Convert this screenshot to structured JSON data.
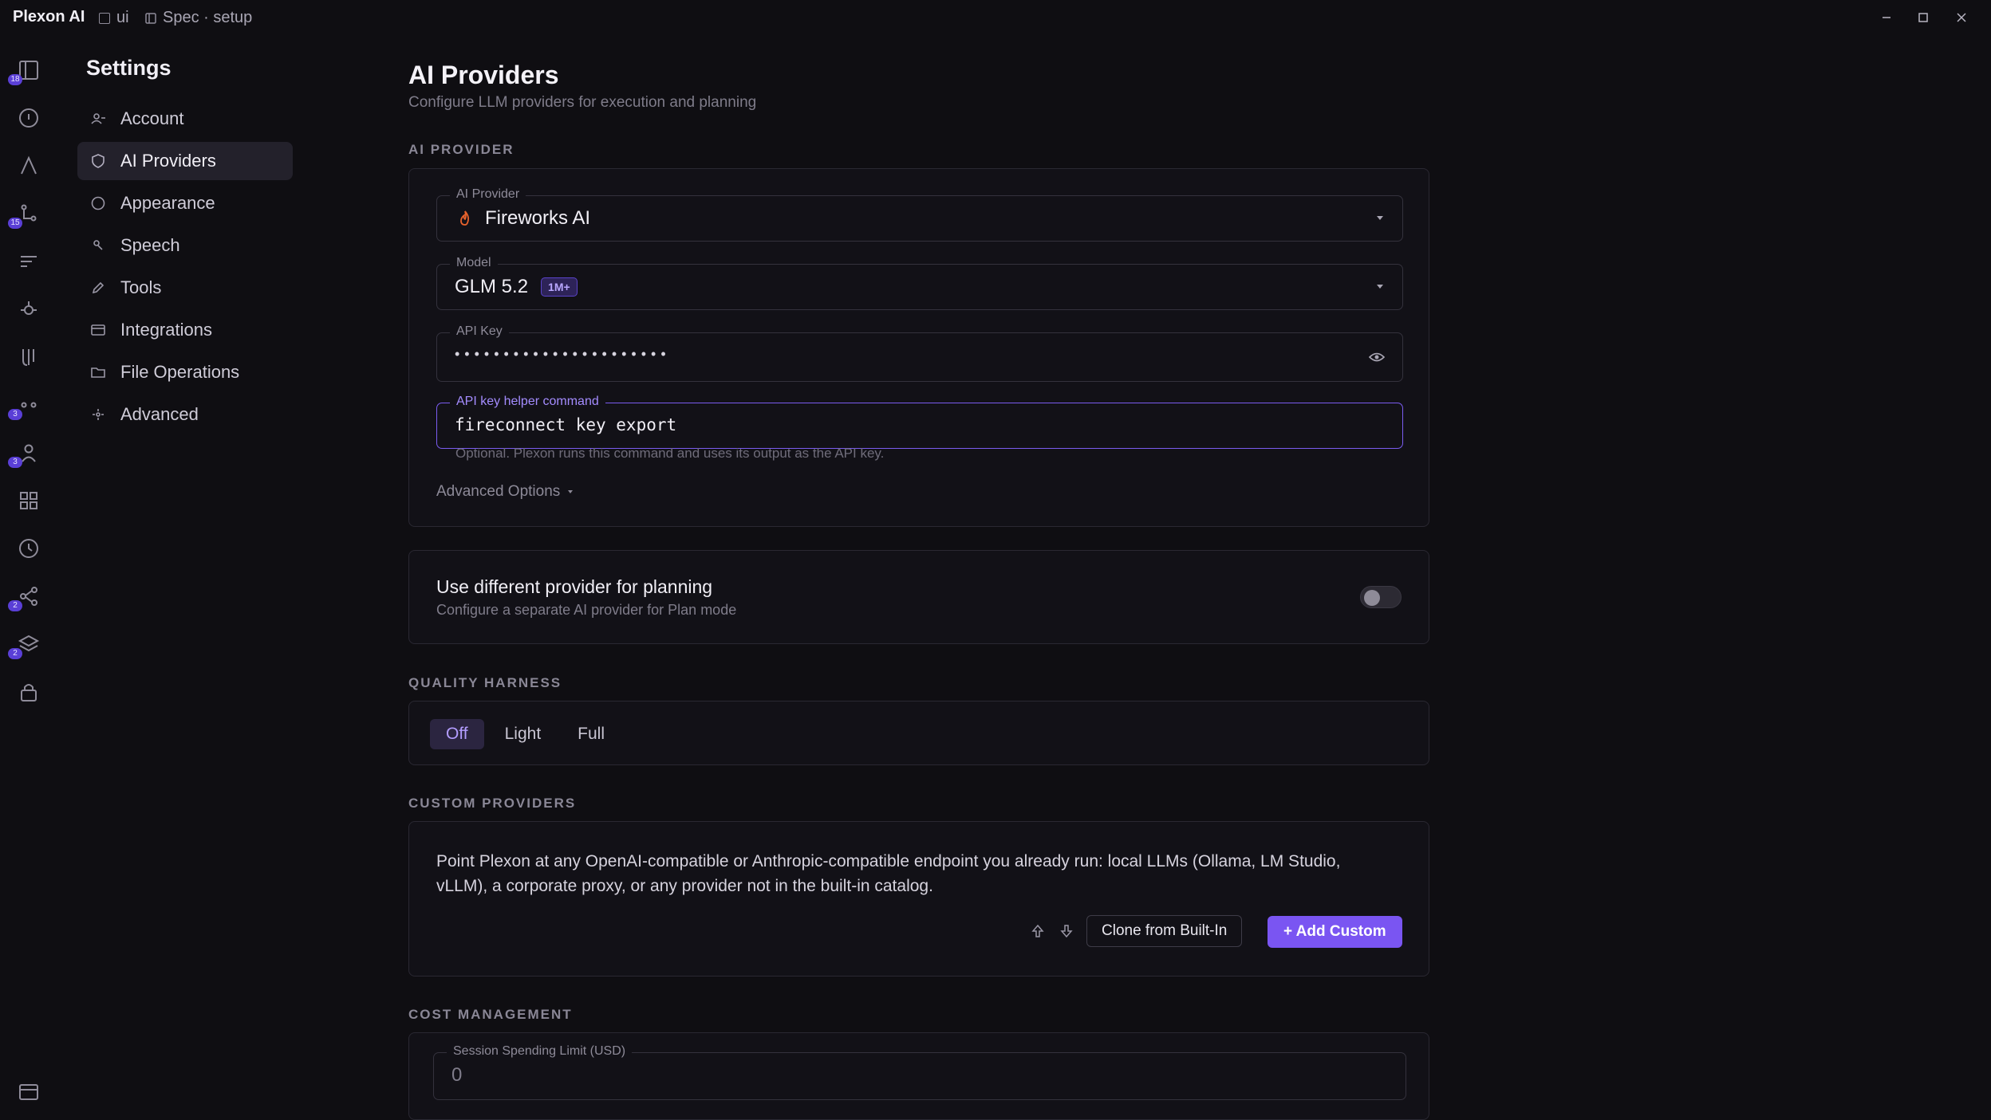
{
  "titlebar": {
    "app_name": "Plexon AI",
    "tabs": [
      {
        "label": "ui",
        "icon": "square-icon"
      },
      {
        "label": "Spec · setup",
        "icon": "panel-icon"
      }
    ]
  },
  "rail": {
    "badges": {
      "panel": "18",
      "branch": "15",
      "dots": "3",
      "user": "3",
      "share": "2",
      "layers": "2"
    }
  },
  "settings": {
    "title": "Settings",
    "nav": [
      {
        "label": "Account",
        "icon": "user-icon"
      },
      {
        "label": "AI Providers",
        "icon": "shield-icon",
        "active": true
      },
      {
        "label": "Appearance",
        "icon": "circle-icon"
      },
      {
        "label": "Speech",
        "icon": "mic-icon"
      },
      {
        "label": "Tools",
        "icon": "pencil-icon"
      },
      {
        "label": "Integrations",
        "icon": "card-icon"
      },
      {
        "label": "File Operations",
        "icon": "folder-icon"
      },
      {
        "label": "Advanced",
        "icon": "sparkle-icon"
      }
    ]
  },
  "page": {
    "title": "AI Providers",
    "subtitle": "Configure LLM providers for execution and planning"
  },
  "ai_provider": {
    "section": "AI PROVIDER",
    "provider_label": "AI Provider",
    "provider_value": "Fireworks AI",
    "model_label": "Model",
    "model_value": "GLM 5.2",
    "model_badge": "1M+",
    "api_key_label": "API Key",
    "api_key_masked": "••••••••••••••••••••••",
    "helper_label": "API key helper command",
    "helper_value": "fireconnect key export",
    "helper_hint": "Optional. Plexon runs this command and uses its output as the API key.",
    "advanced": "Advanced Options"
  },
  "planning": {
    "title": "Use different provider for planning",
    "desc": "Configure a separate AI provider for Plan mode",
    "enabled": false
  },
  "quality": {
    "section": "QUALITY HARNESS",
    "options": [
      "Off",
      "Light",
      "Full"
    ],
    "selected": "Off"
  },
  "custom": {
    "section": "CUSTOM PROVIDERS",
    "desc_line1": "Point Plexon at any OpenAI-compatible or Anthropic-compatible endpoint you already run: local LLMs (Ollama, LM Studio,",
    "desc_line2": "vLLM), a corporate proxy, or any provider not in the built-in catalog.",
    "clone_label": "Clone from Built-In",
    "add_label": "+ Add Custom"
  },
  "cost": {
    "section": "COST MANAGEMENT",
    "limit_label": "Session Spending Limit (USD)",
    "limit_value": "0"
  },
  "colors": {
    "accent": "#7a55f2",
    "flame": "#e8622c"
  }
}
